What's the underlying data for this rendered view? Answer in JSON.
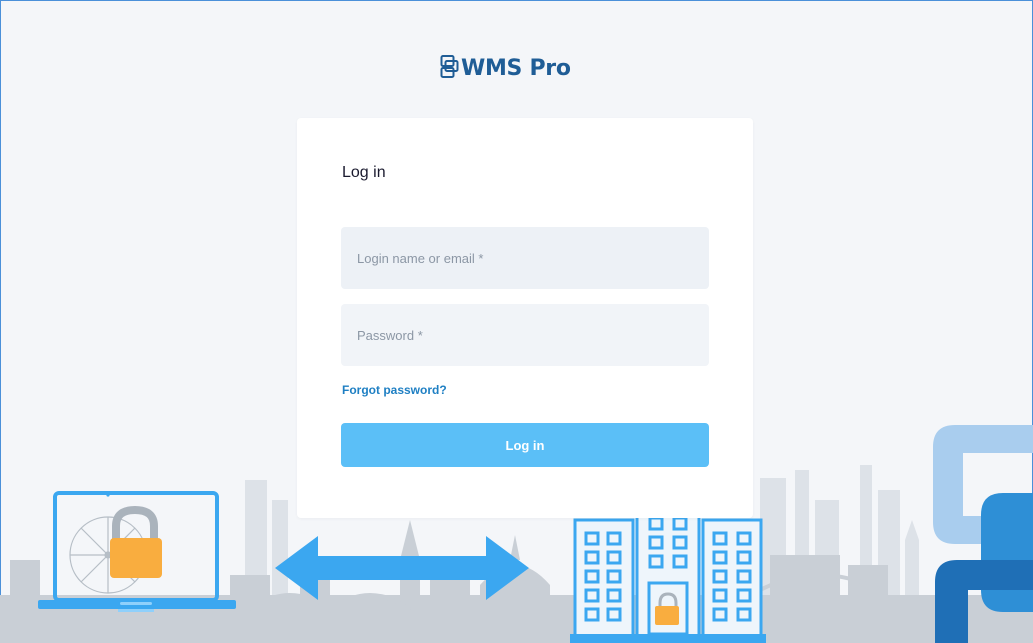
{
  "brand": {
    "name": "WMS Pro",
    "logo_icon": "stacked-windows-icon",
    "color": "#1f5d96"
  },
  "login_card": {
    "title": "Log in",
    "username": {
      "placeholder": "Login name or email *",
      "value": ""
    },
    "password": {
      "placeholder": "Password *",
      "value": ""
    },
    "forgot_link": "Forgot password?",
    "submit_label": "Log in"
  },
  "colors": {
    "accent": "#5bbff7",
    "link": "#1e7fc3",
    "illustration_blue": "#3ba7f0",
    "lock_orange": "#f9ad3f",
    "skyline_grey": "#bcc4cc"
  },
  "illustration": {
    "icons": [
      "laptop-icon",
      "padlock-icon",
      "double-arrow-icon",
      "building-icon",
      "city-skyline",
      "brand-shape"
    ]
  }
}
